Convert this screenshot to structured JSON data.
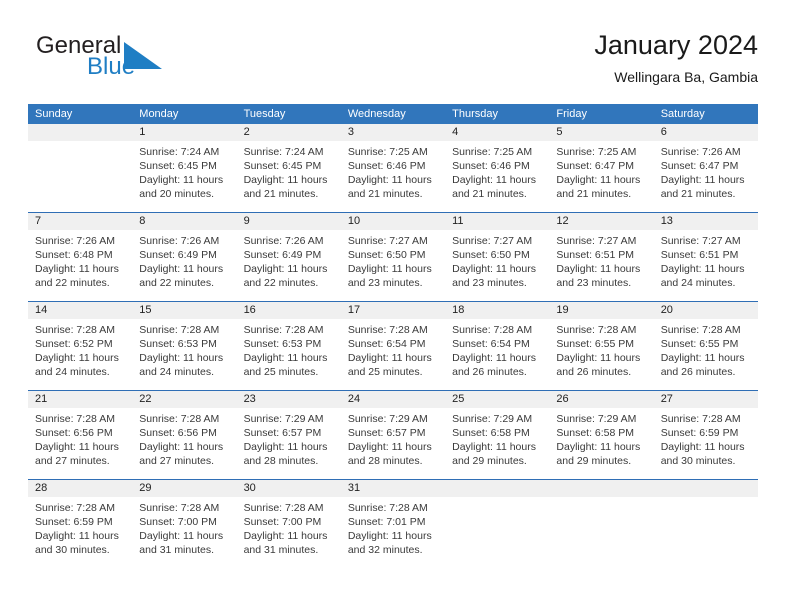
{
  "brand": {
    "name_part1": "General",
    "name_part2": "Blue",
    "logo_icon": "triangle-flag-icon",
    "colors": {
      "text": "#231f20",
      "accent": "#1f7ec4"
    }
  },
  "header": {
    "title": "January 2024",
    "subtitle": "Wellingara Ba, Gambia"
  },
  "calendar": {
    "header_bg": "#3176bc",
    "row_divider": "#2f6eb5",
    "day_number_bg": "#f0f0f0",
    "weekday_headers": [
      "Sunday",
      "Monday",
      "Tuesday",
      "Wednesday",
      "Thursday",
      "Friday",
      "Saturday"
    ],
    "weeks": [
      [
        {
          "day": "",
          "lines": []
        },
        {
          "day": "1",
          "lines": [
            "Sunrise: 7:24 AM",
            "Sunset: 6:45 PM",
            "Daylight: 11 hours",
            "and 20 minutes."
          ]
        },
        {
          "day": "2",
          "lines": [
            "Sunrise: 7:24 AM",
            "Sunset: 6:45 PM",
            "Daylight: 11 hours",
            "and 21 minutes."
          ]
        },
        {
          "day": "3",
          "lines": [
            "Sunrise: 7:25 AM",
            "Sunset: 6:46 PM",
            "Daylight: 11 hours",
            "and 21 minutes."
          ]
        },
        {
          "day": "4",
          "lines": [
            "Sunrise: 7:25 AM",
            "Sunset: 6:46 PM",
            "Daylight: 11 hours",
            "and 21 minutes."
          ]
        },
        {
          "day": "5",
          "lines": [
            "Sunrise: 7:25 AM",
            "Sunset: 6:47 PM",
            "Daylight: 11 hours",
            "and 21 minutes."
          ]
        },
        {
          "day": "6",
          "lines": [
            "Sunrise: 7:26 AM",
            "Sunset: 6:47 PM",
            "Daylight: 11 hours",
            "and 21 minutes."
          ]
        }
      ],
      [
        {
          "day": "7",
          "lines": [
            "Sunrise: 7:26 AM",
            "Sunset: 6:48 PM",
            "Daylight: 11 hours",
            "and 22 minutes."
          ]
        },
        {
          "day": "8",
          "lines": [
            "Sunrise: 7:26 AM",
            "Sunset: 6:49 PM",
            "Daylight: 11 hours",
            "and 22 minutes."
          ]
        },
        {
          "day": "9",
          "lines": [
            "Sunrise: 7:26 AM",
            "Sunset: 6:49 PM",
            "Daylight: 11 hours",
            "and 22 minutes."
          ]
        },
        {
          "day": "10",
          "lines": [
            "Sunrise: 7:27 AM",
            "Sunset: 6:50 PM",
            "Daylight: 11 hours",
            "and 23 minutes."
          ]
        },
        {
          "day": "11",
          "lines": [
            "Sunrise: 7:27 AM",
            "Sunset: 6:50 PM",
            "Daylight: 11 hours",
            "and 23 minutes."
          ]
        },
        {
          "day": "12",
          "lines": [
            "Sunrise: 7:27 AM",
            "Sunset: 6:51 PM",
            "Daylight: 11 hours",
            "and 23 minutes."
          ]
        },
        {
          "day": "13",
          "lines": [
            "Sunrise: 7:27 AM",
            "Sunset: 6:51 PM",
            "Daylight: 11 hours",
            "and 24 minutes."
          ]
        }
      ],
      [
        {
          "day": "14",
          "lines": [
            "Sunrise: 7:28 AM",
            "Sunset: 6:52 PM",
            "Daylight: 11 hours",
            "and 24 minutes."
          ]
        },
        {
          "day": "15",
          "lines": [
            "Sunrise: 7:28 AM",
            "Sunset: 6:53 PM",
            "Daylight: 11 hours",
            "and 24 minutes."
          ]
        },
        {
          "day": "16",
          "lines": [
            "Sunrise: 7:28 AM",
            "Sunset: 6:53 PM",
            "Daylight: 11 hours",
            "and 25 minutes."
          ]
        },
        {
          "day": "17",
          "lines": [
            "Sunrise: 7:28 AM",
            "Sunset: 6:54 PM",
            "Daylight: 11 hours",
            "and 25 minutes."
          ]
        },
        {
          "day": "18",
          "lines": [
            "Sunrise: 7:28 AM",
            "Sunset: 6:54 PM",
            "Daylight: 11 hours",
            "and 26 minutes."
          ]
        },
        {
          "day": "19",
          "lines": [
            "Sunrise: 7:28 AM",
            "Sunset: 6:55 PM",
            "Daylight: 11 hours",
            "and 26 minutes."
          ]
        },
        {
          "day": "20",
          "lines": [
            "Sunrise: 7:28 AM",
            "Sunset: 6:55 PM",
            "Daylight: 11 hours",
            "and 26 minutes."
          ]
        }
      ],
      [
        {
          "day": "21",
          "lines": [
            "Sunrise: 7:28 AM",
            "Sunset: 6:56 PM",
            "Daylight: 11 hours",
            "and 27 minutes."
          ]
        },
        {
          "day": "22",
          "lines": [
            "Sunrise: 7:28 AM",
            "Sunset: 6:56 PM",
            "Daylight: 11 hours",
            "and 27 minutes."
          ]
        },
        {
          "day": "23",
          "lines": [
            "Sunrise: 7:29 AM",
            "Sunset: 6:57 PM",
            "Daylight: 11 hours",
            "and 28 minutes."
          ]
        },
        {
          "day": "24",
          "lines": [
            "Sunrise: 7:29 AM",
            "Sunset: 6:57 PM",
            "Daylight: 11 hours",
            "and 28 minutes."
          ]
        },
        {
          "day": "25",
          "lines": [
            "Sunrise: 7:29 AM",
            "Sunset: 6:58 PM",
            "Daylight: 11 hours",
            "and 29 minutes."
          ]
        },
        {
          "day": "26",
          "lines": [
            "Sunrise: 7:29 AM",
            "Sunset: 6:58 PM",
            "Daylight: 11 hours",
            "and 29 minutes."
          ]
        },
        {
          "day": "27",
          "lines": [
            "Sunrise: 7:28 AM",
            "Sunset: 6:59 PM",
            "Daylight: 11 hours",
            "and 30 minutes."
          ]
        }
      ],
      [
        {
          "day": "28",
          "lines": [
            "Sunrise: 7:28 AM",
            "Sunset: 6:59 PM",
            "Daylight: 11 hours",
            "and 30 minutes."
          ]
        },
        {
          "day": "29",
          "lines": [
            "Sunrise: 7:28 AM",
            "Sunset: 7:00 PM",
            "Daylight: 11 hours",
            "and 31 minutes."
          ]
        },
        {
          "day": "30",
          "lines": [
            "Sunrise: 7:28 AM",
            "Sunset: 7:00 PM",
            "Daylight: 11 hours",
            "and 31 minutes."
          ]
        },
        {
          "day": "31",
          "lines": [
            "Sunrise: 7:28 AM",
            "Sunset: 7:01 PM",
            "Daylight: 11 hours",
            "and 32 minutes."
          ]
        },
        {
          "day": "",
          "lines": []
        },
        {
          "day": "",
          "lines": []
        },
        {
          "day": "",
          "lines": []
        }
      ]
    ]
  }
}
